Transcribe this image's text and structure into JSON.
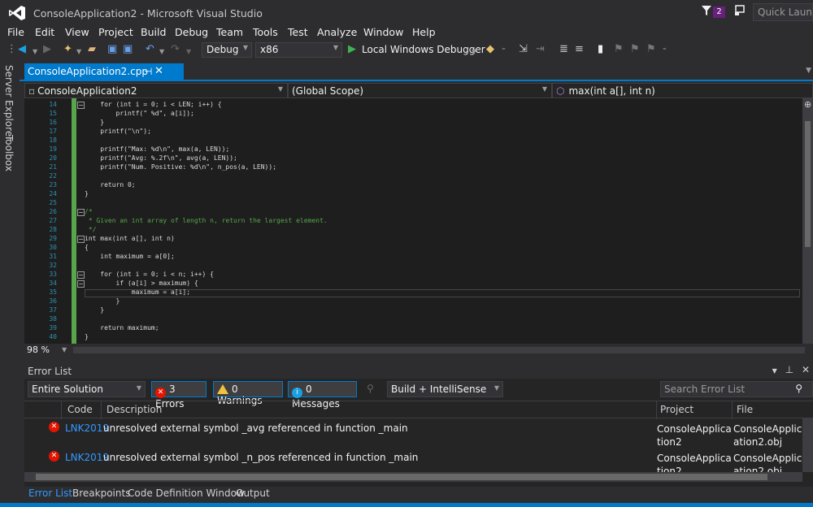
{
  "window": {
    "title": "ConsoleApplication2 - Microsoft Visual Studio",
    "notification_count": "2",
    "quick_launch_placeholder": "Quick Launch"
  },
  "menu": [
    "File",
    "Edit",
    "View",
    "Project",
    "Build",
    "Debug",
    "Team",
    "Tools",
    "Test",
    "Analyze",
    "Window",
    "Help"
  ],
  "toolbar": {
    "config": "Debug",
    "platform": "x86",
    "debugger": "Local Windows Debugger"
  },
  "side_tabs": [
    "Server Explorer",
    "Toolbox"
  ],
  "doc_tab": {
    "name": "ConsoleApplication2.cpp"
  },
  "navbar": {
    "project": "ConsoleApplication2",
    "scope": "(Global Scope)",
    "member": "max(int a[], int n)"
  },
  "editor": {
    "lines": [
      {
        "n": "14",
        "t": "    for (int i = 0; i < LEN; i++) {"
      },
      {
        "n": "15",
        "t": "        printf(\" %d\", a[i]);"
      },
      {
        "n": "16",
        "t": "    }"
      },
      {
        "n": "17",
        "t": "    printf(\"\\n\");"
      },
      {
        "n": "18",
        "t": ""
      },
      {
        "n": "19",
        "t": "    printf(\"Max: %d\\n\", max(a, LEN));"
      },
      {
        "n": "20",
        "t": "    printf(\"Avg: %.2f\\n\", avg(a, LEN));"
      },
      {
        "n": "21",
        "t": "    printf(\"Num. Positive: %d\\n\", n_pos(a, LEN));"
      },
      {
        "n": "22",
        "t": ""
      },
      {
        "n": "23",
        "t": "    return 0;"
      },
      {
        "n": "24",
        "t": "}"
      },
      {
        "n": "25",
        "t": ""
      },
      {
        "n": "26",
        "t": "/*"
      },
      {
        "n": "27",
        "t": " * Given an int array of length n, return the largest element."
      },
      {
        "n": "28",
        "t": " */"
      },
      {
        "n": "29",
        "t": "int max(int a[], int n)"
      },
      {
        "n": "30",
        "t": "{"
      },
      {
        "n": "31",
        "t": "    int maximum = a[0];"
      },
      {
        "n": "32",
        "t": ""
      },
      {
        "n": "33",
        "t": "    for (int i = 0; i < n; i++) {"
      },
      {
        "n": "34",
        "t": "        if (a[i] > maximum) {"
      },
      {
        "n": "35",
        "t": "            maximum = a[i];"
      },
      {
        "n": "36",
        "t": "        }"
      },
      {
        "n": "37",
        "t": "    }"
      },
      {
        "n": "38",
        "t": ""
      },
      {
        "n": "39",
        "t": "    return maximum;"
      },
      {
        "n": "40",
        "t": "}"
      }
    ]
  },
  "zoom": "98 %",
  "error_list": {
    "title": "Error List",
    "scope": "Entire Solution",
    "errors_label": "3 Errors",
    "warnings_label": "0 Warnings",
    "messages_label": "0 Messages",
    "build_filter": "Build + IntelliSense",
    "search_placeholder": "Search Error List",
    "columns": {
      "code": "Code",
      "description": "Description",
      "project": "Project",
      "file": "File"
    },
    "rows": [
      {
        "code": "LNK2019",
        "description": "unresolved external symbol _avg referenced in function _main",
        "project": "ConsoleApplication2",
        "file": "ConsoleApplication2.obj"
      },
      {
        "code": "LNK2019",
        "description": "unresolved external symbol _n_pos referenced in function _main",
        "project": "ConsoleApplication2",
        "file": "ConsoleApplication2.obj"
      }
    ]
  },
  "bottom_tabs": [
    "Error List",
    "Breakpoints",
    "Code Definition Window",
    "Output"
  ],
  "colors": {
    "accent": "#007acc",
    "background": "#2d2d30",
    "editor_bg": "#1e1e1e",
    "error": "#e51400",
    "link": "#3399ff"
  }
}
